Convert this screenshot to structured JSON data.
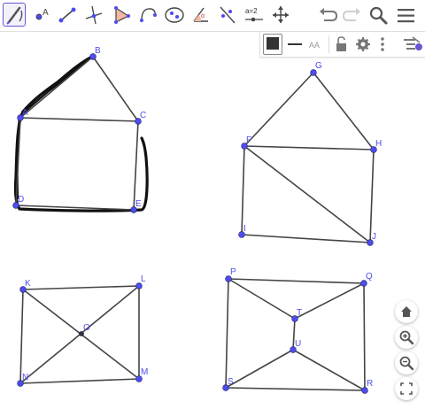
{
  "toolbar": {
    "tools": [
      {
        "name": "pen-tool",
        "active": true
      },
      {
        "name": "point-tool",
        "active": false
      },
      {
        "name": "segment-tool",
        "active": false
      },
      {
        "name": "perpendicular-tool",
        "active": false
      },
      {
        "name": "polygon-tool",
        "active": false
      },
      {
        "name": "circle-arc-tool",
        "active": false
      },
      {
        "name": "ellipse-tool",
        "active": false
      },
      {
        "name": "angle-tool",
        "active": false
      },
      {
        "name": "reflect-tool",
        "active": false
      },
      {
        "name": "slider-tool",
        "active": false
      },
      {
        "name": "move-graphics-view-tool",
        "active": false
      }
    ],
    "slider_tool_label": "a=2",
    "actions": [
      "undo-icon",
      "redo-icon",
      "search-icon",
      "menu-icon"
    ]
  },
  "style_bar": {
    "color": "#333333",
    "items": [
      "color-swatch",
      "line-style-icon",
      "label-style-icon",
      "lock-icon",
      "gear-icon",
      "more-vert-icon",
      "algebra-toggle-icon"
    ]
  },
  "points": [
    {
      "label": "A"
    },
    {
      "label": "B"
    },
    {
      "label": "C"
    },
    {
      "label": "D"
    },
    {
      "label": "E"
    },
    {
      "label": "F"
    },
    {
      "label": "G"
    },
    {
      "label": "H"
    },
    {
      "label": "I"
    },
    {
      "label": "J"
    },
    {
      "label": "K"
    },
    {
      "label": "L"
    },
    {
      "label": "M"
    },
    {
      "label": "N"
    },
    {
      "label": "O"
    },
    {
      "label": "P"
    },
    {
      "label": "Q"
    },
    {
      "label": "R"
    },
    {
      "label": "S"
    },
    {
      "label": "T"
    },
    {
      "label": "U"
    }
  ],
  "segments": [
    [
      "A",
      "B"
    ],
    [
      "B",
      "C"
    ],
    [
      "A",
      "C"
    ],
    [
      "C",
      "E"
    ],
    [
      "E",
      "D"
    ],
    [
      "D",
      "A"
    ],
    [
      "F",
      "G"
    ],
    [
      "G",
      "H"
    ],
    [
      "F",
      "H"
    ],
    [
      "H",
      "J"
    ],
    [
      "J",
      "I"
    ],
    [
      "I",
      "F"
    ],
    [
      "F",
      "J"
    ],
    [
      "K",
      "L"
    ],
    [
      "L",
      "M"
    ],
    [
      "M",
      "N"
    ],
    [
      "N",
      "K"
    ],
    [
      "K",
      "M"
    ],
    [
      "N",
      "L"
    ],
    [
      "P",
      "Q"
    ],
    [
      "Q",
      "R"
    ],
    [
      "R",
      "S"
    ],
    [
      "S",
      "P"
    ],
    [
      "P",
      "T"
    ],
    [
      "Q",
      "T"
    ],
    [
      "T",
      "U"
    ],
    [
      "U",
      "S"
    ],
    [
      "U",
      "R"
    ]
  ],
  "navigation": [
    "home-icon",
    "zoom-in-icon",
    "zoom-out-icon",
    "fullscreen-icon"
  ],
  "colors": {
    "point": "#4c4cf0",
    "segment": "#444444",
    "ink": "#111111",
    "accent": "#6557d2",
    "icon": "#555555"
  }
}
